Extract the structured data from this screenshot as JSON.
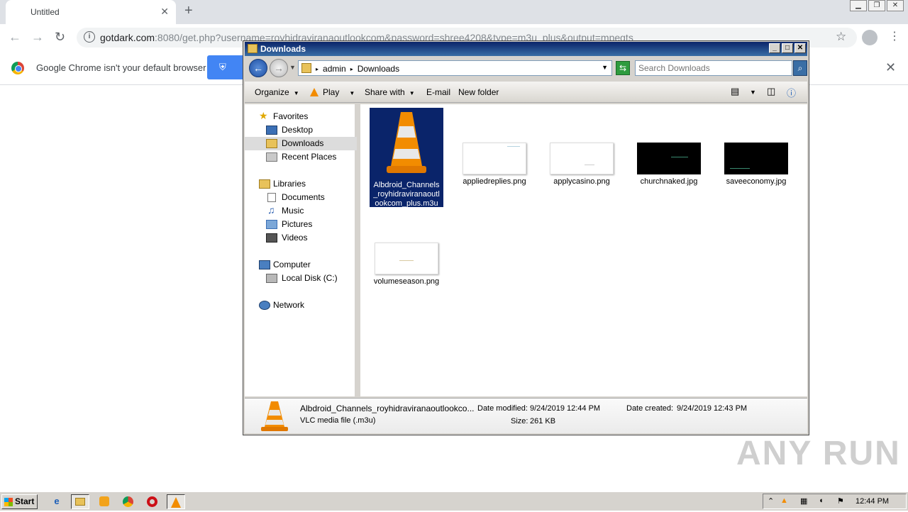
{
  "chrome": {
    "tab_title": "Untitled",
    "url_host": "gotdark.com",
    "url_rest": ":8080/get.php?username=royhidraviranaoutlookcom&password=shree4208&type=m3u_plus&output=mpegts",
    "infobar_message": "Google Chrome isn't your default browser"
  },
  "explorer": {
    "title": "Downloads",
    "breadcrumb": [
      "admin",
      "Downloads"
    ],
    "search_placeholder": "Search Downloads",
    "commands": {
      "organize": "Organize",
      "play": "Play",
      "share_with": "Share with",
      "email": "E-mail",
      "new_folder": "New folder"
    },
    "nav": {
      "favorites": "Favorites",
      "desktop": "Desktop",
      "downloads": "Downloads",
      "recent_places": "Recent Places",
      "libraries": "Libraries",
      "documents": "Documents",
      "music": "Music",
      "pictures": "Pictures",
      "videos": "Videos",
      "computer": "Computer",
      "local_disk": "Local Disk (C:)",
      "network": "Network"
    },
    "files": [
      {
        "name": "Albdroid_Channels_royhidraviranaoutlookcom_plus.m3u",
        "kind": "vlc"
      },
      {
        "name": "appliedreplies.png",
        "kind": "white"
      },
      {
        "name": "applycasino.png",
        "kind": "white"
      },
      {
        "name": "churchnaked.jpg",
        "kind": "black"
      },
      {
        "name": "saveeconomy.jpg",
        "kind": "black"
      },
      {
        "name": "volumeseason.png",
        "kind": "white"
      }
    ],
    "details": {
      "filename": "Albdroid_Channels_royhidraviranaoutlookco...",
      "filetype": "VLC media file (.m3u)",
      "date_modified_label": "Date modified:",
      "date_modified": "9/24/2019 12:44 PM",
      "date_created_label": "Date created:",
      "date_created": "9/24/2019 12:43 PM",
      "size_label": "Size:",
      "size": "261 KB"
    }
  },
  "taskbar": {
    "start_label": "Start",
    "clock": "12:44 PM"
  },
  "watermark": "ANY RUN"
}
